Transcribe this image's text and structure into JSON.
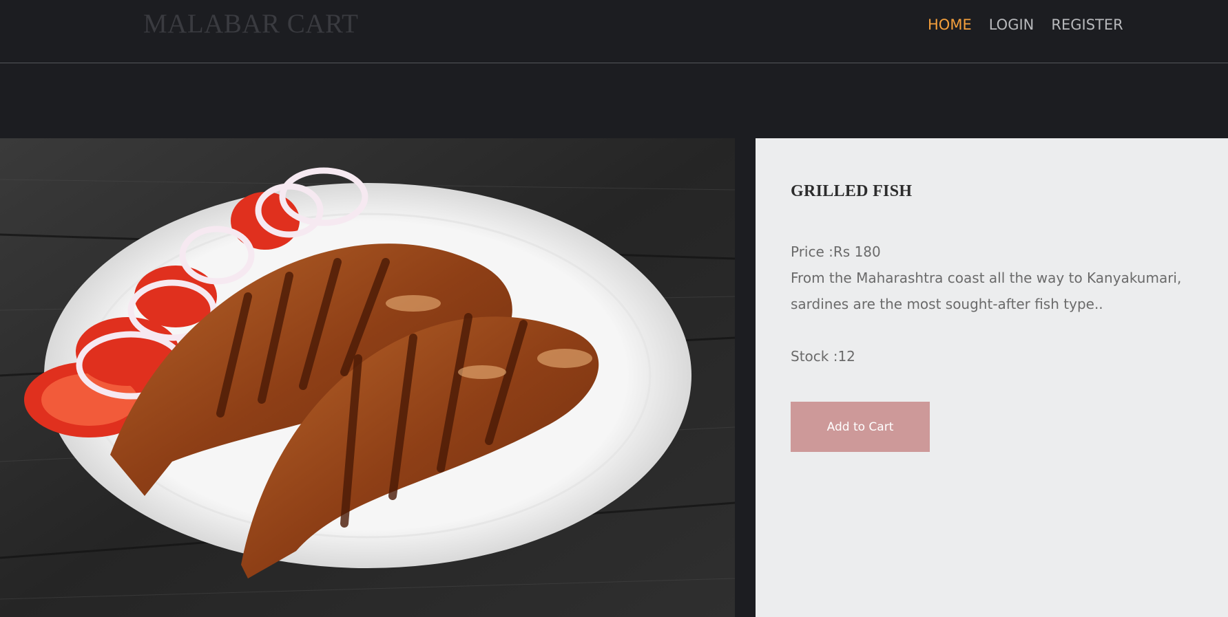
{
  "header": {
    "brand": "MALABAR CART",
    "nav": [
      {
        "label": "HOME",
        "active": true
      },
      {
        "label": "LOGIN",
        "active": false
      },
      {
        "label": "REGISTER",
        "active": false
      }
    ]
  },
  "product": {
    "image_icon": "grilled-fish-photo",
    "title": "GRILLED FISH",
    "price_label": "Price :",
    "price_value": "Rs 180",
    "description": "From the Maharashtra coast all the way to Kanyakumari, sardines are the most sought-after fish type..",
    "stock_label": "Stock :",
    "stock_value": "12",
    "add_to_cart_label": "Add to Cart"
  },
  "colors": {
    "background": "#1c1d21",
    "nav_active": "#f5a03c",
    "panel": "#ecedee",
    "button": "#cd9999"
  }
}
